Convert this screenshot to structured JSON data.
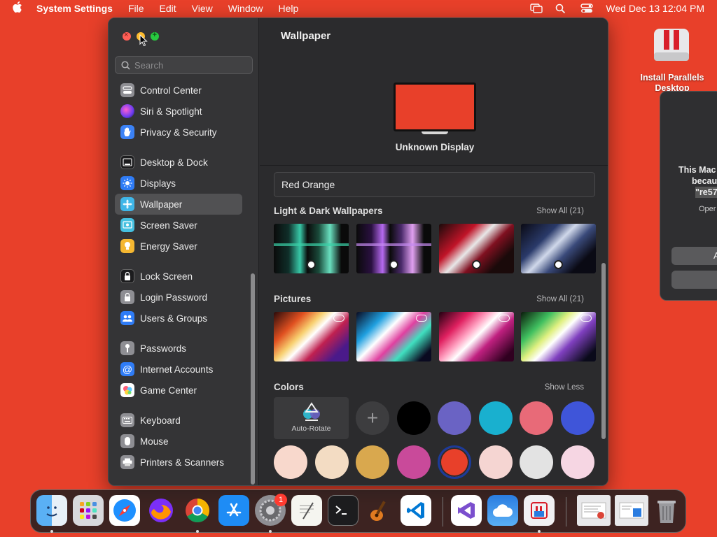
{
  "menubar": {
    "app_name": "System Settings",
    "menus": [
      "File",
      "Edit",
      "View",
      "Window",
      "Help"
    ],
    "clock": "Wed Dec 13  12:04 PM"
  },
  "sidebar": {
    "search_placeholder": "Search",
    "items": [
      {
        "label": "Control Center",
        "icon": "control-center-icon",
        "color": "#8e8e93"
      },
      {
        "label": "Siri & Spotlight",
        "icon": "siri-icon",
        "color": "#b23cd9"
      },
      {
        "label": "Privacy & Security",
        "icon": "hand-icon",
        "color": "#3b82f6"
      },
      {
        "label": "Desktop & Dock",
        "icon": "dock-icon",
        "color": "#1c1c1e"
      },
      {
        "label": "Displays",
        "icon": "sun-icon",
        "color": "#2f7cf6"
      },
      {
        "label": "Wallpaper",
        "icon": "wallpaper-icon",
        "color": "#3fb6e8"
      },
      {
        "label": "Screen Saver",
        "icon": "screensaver-icon",
        "color": "#45c0e0"
      },
      {
        "label": "Energy Saver",
        "icon": "bulb-icon",
        "color": "#f5b731"
      },
      {
        "label": "Lock Screen",
        "icon": "lock-icon",
        "color": "#1c1c1e"
      },
      {
        "label": "Login Password",
        "icon": "login-lock-icon",
        "color": "#8e8e93"
      },
      {
        "label": "Users & Groups",
        "icon": "users-icon",
        "color": "#2f7cf6"
      },
      {
        "label": "Passwords",
        "icon": "key-icon",
        "color": "#8e8e93"
      },
      {
        "label": "Internet Accounts",
        "icon": "at-icon",
        "color": "#2f7cf6"
      },
      {
        "label": "Game Center",
        "icon": "game-center-icon",
        "color": "#ffffff"
      },
      {
        "label": "Keyboard",
        "icon": "keyboard-icon",
        "color": "#8e8e93"
      },
      {
        "label": "Mouse",
        "icon": "mouse-icon",
        "color": "#8e8e93"
      },
      {
        "label": "Printers & Scanners",
        "icon": "printer-icon",
        "color": "#8e8e93"
      }
    ]
  },
  "main": {
    "title": "Wallpaper",
    "display_label": "Unknown Display",
    "wallpaper_name": "Red Orange",
    "sections": {
      "light_dark": {
        "title": "Light & Dark Wallpapers",
        "show_all": "Show All (21)"
      },
      "pictures": {
        "title": "Pictures",
        "show_all": "Show All (21)"
      },
      "colors": {
        "title": "Colors",
        "show_less": "Show Less",
        "auto_rotate": "Auto-Rotate"
      }
    },
    "color_swatches_row1": [
      "#000000",
      "#6a63c4",
      "#19b0cf",
      "#e86a78",
      "#3f55d9"
    ],
    "color_swatches_row2": [
      "#f8d8cc",
      "#f3dcc3",
      "#d9a84e",
      "#c94a9a",
      "#e8402a",
      "#f5d5d2",
      "#e3e3e3",
      "#f6d6e3"
    ],
    "selected_color": "#e8402a"
  },
  "desktop": {
    "parallels_label": "Install Parallels Desktop",
    "alert_line1": "This Mac",
    "alert_line2": "becau",
    "alert_line3": "\"re57",
    "alert_sub": "Oper",
    "alert_button": "A"
  },
  "dock": {
    "badge_count": "1",
    "apps": [
      "finder-icon",
      "launchpad-icon",
      "safari-icon",
      "firefox-icon",
      "chrome-icon",
      "app-store-icon",
      "system-settings-icon",
      "textedit-icon",
      "terminal-icon",
      "garageband-icon",
      "vscode-icon",
      "visual-studio-icon",
      "icloud-icon",
      "parallels-dock-icon",
      "downloads-icon",
      "documents-icon",
      "trash-icon"
    ]
  }
}
